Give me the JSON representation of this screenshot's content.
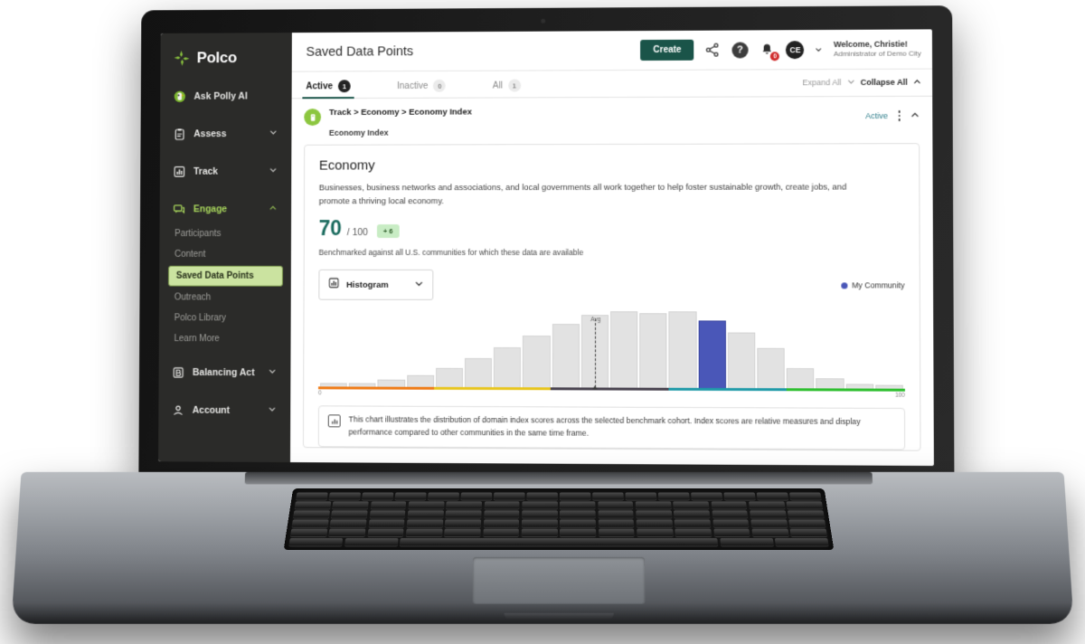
{
  "sidebar": {
    "brand": "Polco",
    "items": [
      {
        "label": "Ask Polly AI",
        "icon": "parrot-icon",
        "expandable": false,
        "accent": false
      },
      {
        "label": "Assess",
        "icon": "clipboard-icon",
        "expandable": true,
        "accent": false
      },
      {
        "label": "Track",
        "icon": "bar-chart-icon",
        "expandable": true,
        "accent": false
      },
      {
        "label": "Engage",
        "icon": "chat-icon",
        "expandable": true,
        "accent": true
      },
      {
        "label": "Balancing Act",
        "icon": "balance-icon",
        "expandable": true,
        "accent": false
      },
      {
        "label": "Account",
        "icon": "person-icon",
        "expandable": true,
        "accent": false
      }
    ],
    "engage_subitems": [
      {
        "label": "Participants",
        "active": false
      },
      {
        "label": "Content",
        "active": false
      },
      {
        "label": "Saved Data Points",
        "active": true
      },
      {
        "label": "Outreach",
        "active": false
      },
      {
        "label": "Polco Library",
        "active": false
      },
      {
        "label": "Learn More",
        "active": false
      }
    ]
  },
  "header": {
    "title": "Saved Data Points",
    "create_label": "Create",
    "share_icon": "share-icon",
    "help_icon": "help-icon",
    "help_glyph": "?",
    "bell_icon": "bell-icon",
    "bell_badge": "0",
    "avatar_initials": "CE",
    "welcome_line1": "Welcome, Christie!",
    "welcome_line2": "Administrator of Demo City"
  },
  "tabs": [
    {
      "label": "Active",
      "count": "1",
      "active": true
    },
    {
      "label": "Inactive",
      "count": "0",
      "active": false
    },
    {
      "label": "All",
      "count": "1",
      "active": false
    }
  ],
  "toolbar": {
    "expand_all": "Expand All",
    "collapse_all": "Collapse All"
  },
  "record": {
    "breadcrumb": "Track > Economy > Economy Index",
    "subtitle": "Economy Index",
    "status": "Active"
  },
  "card": {
    "title": "Economy",
    "description": "Businesses, business networks and associations, and local governments all work together to help foster sustainable growth, create jobs, and promote a thriving local economy.",
    "score": "70",
    "score_denominator": "/ 100",
    "score_delta": "+ 6",
    "benchmark_note": "Benchmarked against all U.S. communities for which these data are available",
    "chart_select_label": "Histogram",
    "legend_label": "My Community",
    "footer_note": "This chart illustrates the distribution of domain index scores across the selected benchmark cohort. Index scores are relative measures and display performance compared to other communities in the same time frame."
  },
  "colors": {
    "brand_green": "#8cc63f",
    "dark_teal": "#1a5449",
    "score_teal": "#1a6b5e",
    "my_community_blue": "#4a57b8",
    "bar_grey": "#e2e2e2",
    "axis_orange": "#ef7c18",
    "axis_yellow": "#e8c51c",
    "axis_charcoal": "#4a4450",
    "axis_teal": "#1f9aa8",
    "axis_green": "#2fbf30"
  },
  "chart_data": {
    "type": "bar",
    "title": "",
    "subtitle": "Distribution of domain index scores across benchmark cohort",
    "xlabel": "",
    "ylabel": "",
    "xlim": [
      0,
      100
    ],
    "grid": false,
    "legend_position": "top-right",
    "tick_labels": [
      "0",
      "100"
    ],
    "avg_label": "Avg",
    "avg_index": 9,
    "highlight_index": 13,
    "highlight_label": "My Community",
    "categories": [
      "0-5",
      "5-10",
      "10-15",
      "15-20",
      "20-25",
      "25-30",
      "30-35",
      "35-40",
      "40-45",
      "45-50",
      "50-55",
      "55-60",
      "60-65",
      "65-70",
      "70-75",
      "75-80",
      "80-85",
      "85-90",
      "90-95",
      "95-100"
    ],
    "values": [
      4,
      4,
      8,
      13,
      21,
      32,
      44,
      57,
      70,
      80,
      84,
      82,
      84,
      74,
      61,
      44,
      22,
      11,
      5,
      4
    ],
    "axis_segments": [
      {
        "color": "#ef7c18",
        "span": 5
      },
      {
        "color": "#e8c51c",
        "span": 5
      },
      {
        "color": "#4a4450",
        "span": 5
      },
      {
        "color": "#1f9aa8",
        "span": 5
      },
      {
        "color": "#2fbf30",
        "span": 5
      }
    ]
  }
}
